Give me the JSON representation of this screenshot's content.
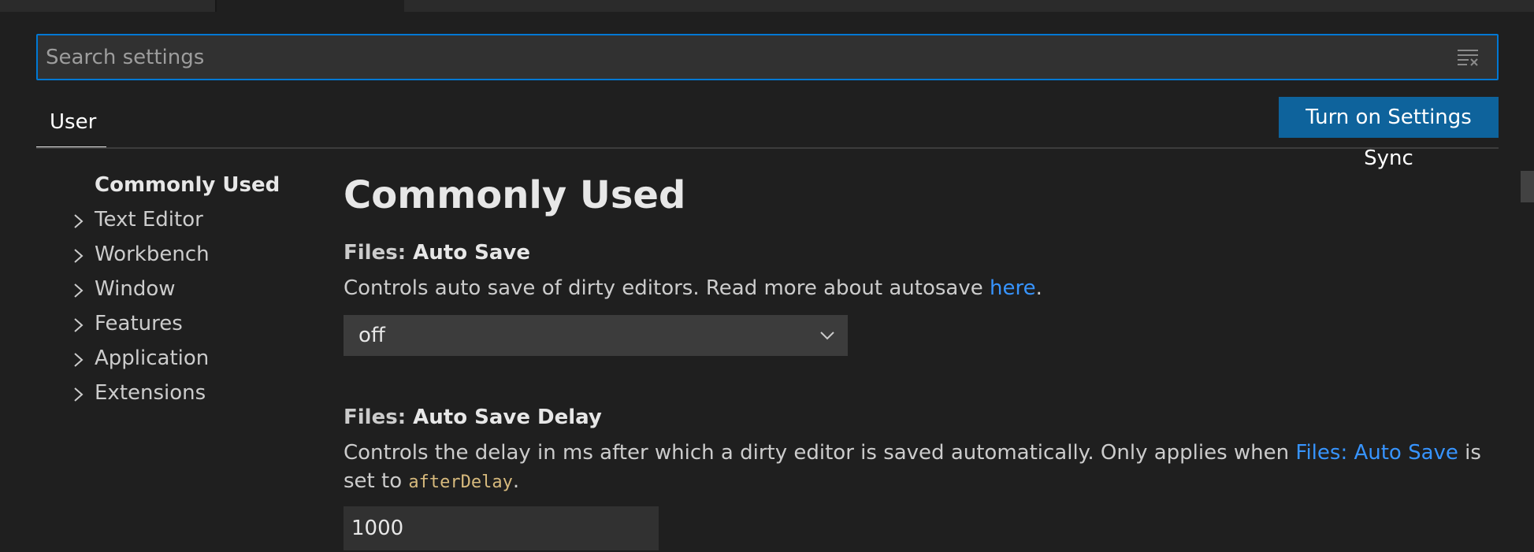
{
  "search": {
    "placeholder": "Search settings",
    "value": ""
  },
  "scope_tabs": [
    {
      "label": "User",
      "active": true
    }
  ],
  "sync_button": {
    "label": "Turn on Settings Sync"
  },
  "toc": {
    "items": [
      {
        "label": "Commonly Used",
        "active": true,
        "expandable": false
      },
      {
        "label": "Text Editor",
        "active": false,
        "expandable": true
      },
      {
        "label": "Workbench",
        "active": false,
        "expandable": true
      },
      {
        "label": "Window",
        "active": false,
        "expandable": true
      },
      {
        "label": "Features",
        "active": false,
        "expandable": true
      },
      {
        "label": "Application",
        "active": false,
        "expandable": true
      },
      {
        "label": "Extensions",
        "active": false,
        "expandable": true
      }
    ]
  },
  "content": {
    "section_title": "Commonly Used",
    "settings": [
      {
        "category": "Files: ",
        "name": "Auto Save",
        "desc_before": "Controls auto save of dirty editors. Read more about autosave ",
        "desc_link": "here",
        "desc_after": ".",
        "control": "dropdown",
        "value": "off"
      },
      {
        "category": "Files: ",
        "name": "Auto Save Delay",
        "desc_before": "Controls the delay in ms after which a dirty editor is saved automatically. Only applies when ",
        "desc_link": "Files: Auto Save",
        "desc_middle": " is set to ",
        "desc_code": "afterDelay",
        "desc_after": ".",
        "control": "number",
        "value": "1000"
      }
    ]
  },
  "colors": {
    "background": "#1f1f1f",
    "focus_border": "#0078d4",
    "button_bg": "#0e639c",
    "link": "#3794ff",
    "code": "#d7ba7d"
  }
}
